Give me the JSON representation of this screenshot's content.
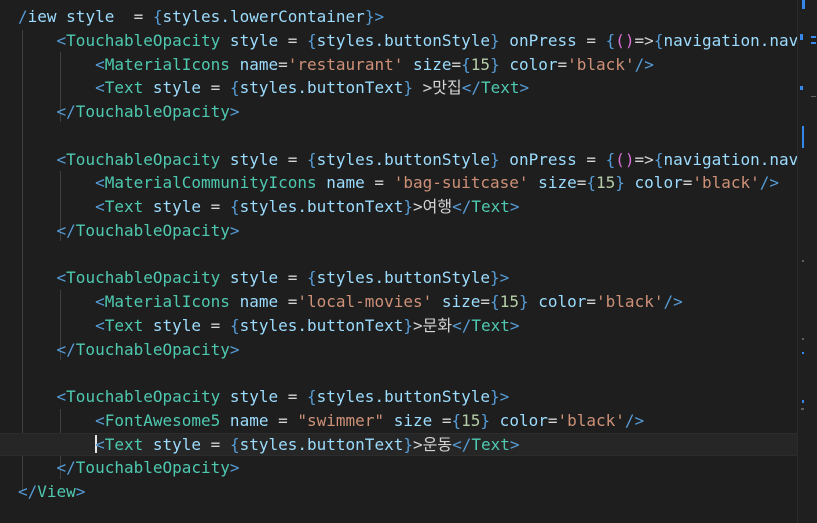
{
  "theme": {
    "background": "#1e1e1e",
    "tag": "#569cd6",
    "component": "#4ec9b0",
    "attribute": "#9cdcfe",
    "string": "#ce9178",
    "number": "#b5cea8",
    "brace": "#569cd6",
    "paren": "#da70d6",
    "text": "#d4d4d4"
  },
  "editor": {
    "current_line": 18,
    "lines": [
      [
        [
          "d",
          "/"
        ],
        [
          "a",
          "iew style "
        ],
        [
          "t",
          " = "
        ],
        [
          "b",
          "{"
        ],
        [
          "a",
          "styles.lowerContainer"
        ],
        [
          "b",
          "}"
        ],
        [
          "d",
          ">"
        ]
      ],
      [
        [
          "t",
          "    "
        ],
        [
          "d",
          "<"
        ],
        [
          "c",
          "TouchableOpacity"
        ],
        [
          "a",
          " style "
        ],
        [
          "t",
          "= "
        ],
        [
          "b",
          "{"
        ],
        [
          "a",
          "styles.buttonStyle"
        ],
        [
          "b",
          "}"
        ],
        [
          "a",
          " onPress "
        ],
        [
          "t",
          "= "
        ],
        [
          "b",
          "{"
        ],
        [
          "y",
          "()"
        ],
        [
          "t",
          "=>"
        ],
        [
          "b",
          "{"
        ],
        [
          "a",
          "navigation.navi"
        ]
      ],
      [
        [
          "t",
          "        "
        ],
        [
          "d",
          "<"
        ],
        [
          "c",
          "MaterialIcons"
        ],
        [
          "a",
          " name"
        ],
        [
          "t",
          "="
        ],
        [
          "s",
          "'restaurant'"
        ],
        [
          "a",
          " size"
        ],
        [
          "t",
          "="
        ],
        [
          "b",
          "{"
        ],
        [
          "n",
          "15"
        ],
        [
          "b",
          "}"
        ],
        [
          "a",
          " color"
        ],
        [
          "t",
          "="
        ],
        [
          "s",
          "'black'"
        ],
        [
          "d",
          "/>"
        ]
      ],
      [
        [
          "t",
          "        "
        ],
        [
          "d",
          "<"
        ],
        [
          "c",
          "Text"
        ],
        [
          "a",
          " style "
        ],
        [
          "t",
          "= "
        ],
        [
          "b",
          "{"
        ],
        [
          "a",
          "styles.buttonText"
        ],
        [
          "b",
          "}"
        ],
        [
          "t",
          " >맛집"
        ],
        [
          "d",
          "</"
        ],
        [
          "c",
          "Text"
        ],
        [
          "d",
          ">"
        ]
      ],
      [
        [
          "t",
          "    "
        ],
        [
          "d",
          "</"
        ],
        [
          "c",
          "TouchableOpacity"
        ],
        [
          "d",
          ">"
        ]
      ],
      [],
      [
        [
          "t",
          "    "
        ],
        [
          "d",
          "<"
        ],
        [
          "c",
          "TouchableOpacity"
        ],
        [
          "a",
          " style "
        ],
        [
          "t",
          "= "
        ],
        [
          "b",
          "{"
        ],
        [
          "a",
          "styles.buttonStyle"
        ],
        [
          "b",
          "}"
        ],
        [
          "a",
          " onPress "
        ],
        [
          "t",
          "= "
        ],
        [
          "b",
          "{"
        ],
        [
          "y",
          "()"
        ],
        [
          "t",
          "=>"
        ],
        [
          "b",
          "{"
        ],
        [
          "a",
          "navigation.navi"
        ]
      ],
      [
        [
          "t",
          "        "
        ],
        [
          "d",
          "<"
        ],
        [
          "c",
          "MaterialCommunityIcons"
        ],
        [
          "a",
          " name "
        ],
        [
          "t",
          "= "
        ],
        [
          "s",
          "'bag-suitcase'"
        ],
        [
          "a",
          " size"
        ],
        [
          "t",
          "="
        ],
        [
          "b",
          "{"
        ],
        [
          "n",
          "15"
        ],
        [
          "b",
          "}"
        ],
        [
          "a",
          " color"
        ],
        [
          "t",
          "="
        ],
        [
          "s",
          "'black'"
        ],
        [
          "d",
          "/>"
        ]
      ],
      [
        [
          "t",
          "        "
        ],
        [
          "d",
          "<"
        ],
        [
          "c",
          "Text"
        ],
        [
          "a",
          " style "
        ],
        [
          "t",
          "= "
        ],
        [
          "b",
          "{"
        ],
        [
          "a",
          "styles.buttonText"
        ],
        [
          "b",
          "}"
        ],
        [
          "t",
          ">여행"
        ],
        [
          "d",
          "</"
        ],
        [
          "c",
          "Text"
        ],
        [
          "d",
          ">"
        ]
      ],
      [
        [
          "t",
          "    "
        ],
        [
          "d",
          "</"
        ],
        [
          "c",
          "TouchableOpacity"
        ],
        [
          "d",
          ">"
        ]
      ],
      [],
      [
        [
          "t",
          "    "
        ],
        [
          "d",
          "<"
        ],
        [
          "c",
          "TouchableOpacity"
        ],
        [
          "a",
          " style "
        ],
        [
          "t",
          "= "
        ],
        [
          "b",
          "{"
        ],
        [
          "a",
          "styles.buttonStyle"
        ],
        [
          "b",
          "}"
        ],
        [
          "d",
          ">"
        ]
      ],
      [
        [
          "t",
          "        "
        ],
        [
          "d",
          "<"
        ],
        [
          "c",
          "MaterialIcons"
        ],
        [
          "a",
          " name "
        ],
        [
          "t",
          "="
        ],
        [
          "s",
          "'local-movies'"
        ],
        [
          "a",
          " size"
        ],
        [
          "t",
          "="
        ],
        [
          "b",
          "{"
        ],
        [
          "n",
          "15"
        ],
        [
          "b",
          "}"
        ],
        [
          "a",
          " color"
        ],
        [
          "t",
          "="
        ],
        [
          "s",
          "'black'"
        ],
        [
          "d",
          "/>"
        ]
      ],
      [
        [
          "t",
          "        "
        ],
        [
          "d",
          "<"
        ],
        [
          "c",
          "Text"
        ],
        [
          "a",
          " style "
        ],
        [
          "t",
          "= "
        ],
        [
          "b",
          "{"
        ],
        [
          "a",
          "styles.buttonText"
        ],
        [
          "b",
          "}"
        ],
        [
          "t",
          ">문화"
        ],
        [
          "d",
          "</"
        ],
        [
          "c",
          "Text"
        ],
        [
          "d",
          ">"
        ]
      ],
      [
        [
          "t",
          "    "
        ],
        [
          "d",
          "</"
        ],
        [
          "c",
          "TouchableOpacity"
        ],
        [
          "d",
          ">"
        ]
      ],
      [],
      [
        [
          "t",
          "    "
        ],
        [
          "d",
          "<"
        ],
        [
          "c",
          "TouchableOpacity"
        ],
        [
          "a",
          " style "
        ],
        [
          "t",
          "= "
        ],
        [
          "b",
          "{"
        ],
        [
          "a",
          "styles.buttonStyle"
        ],
        [
          "b",
          "}"
        ],
        [
          "d",
          ">"
        ]
      ],
      [
        [
          "t",
          "        "
        ],
        [
          "d",
          "<"
        ],
        [
          "c",
          "FontAwesome5"
        ],
        [
          "a",
          " name "
        ],
        [
          "t",
          "= "
        ],
        [
          "s",
          "\"swimmer\""
        ],
        [
          "a",
          " size "
        ],
        [
          "t",
          "="
        ],
        [
          "b",
          "{"
        ],
        [
          "n",
          "15"
        ],
        [
          "b",
          "}"
        ],
        [
          "a",
          " color"
        ],
        [
          "t",
          "="
        ],
        [
          "s",
          "'black'"
        ],
        [
          "d",
          "/>"
        ]
      ],
      [
        [
          "t",
          "        "
        ],
        [
          "caret",
          ""
        ],
        [
          "d",
          "<"
        ],
        [
          "c",
          "Text"
        ],
        [
          "a",
          " style "
        ],
        [
          "t",
          "= "
        ],
        [
          "b",
          "{"
        ],
        [
          "a",
          "styles.buttonText"
        ],
        [
          "b",
          "}"
        ],
        [
          "t",
          ">운동"
        ],
        [
          "d",
          "</"
        ],
        [
          "c",
          "Text"
        ],
        [
          "d",
          ">"
        ]
      ],
      [
        [
          "t",
          "    "
        ],
        [
          "d",
          "</"
        ],
        [
          "c",
          "TouchableOpacity"
        ],
        [
          "d",
          ">"
        ]
      ],
      [
        [
          "d",
          "</"
        ],
        [
          "c",
          "View"
        ],
        [
          "d",
          ">"
        ]
      ]
    ]
  },
  "minimap": {
    "marks": [
      {
        "color": "#3794ff"
      },
      {
        "color": "#3794ff"
      },
      {
        "color": "#3794ff"
      },
      {
        "color": "#3794ff"
      },
      {
        "color": "#3794ff"
      },
      {
        "color": "#3794ff"
      },
      {
        "color": "#d4d4d4"
      },
      {
        "color": "#d4d4d4"
      },
      {
        "color": "#3794ff"
      },
      {
        "color": "#d4d4d4"
      },
      {
        "color": "#3794ff"
      },
      {
        "color": "#d4d4d4"
      }
    ]
  }
}
